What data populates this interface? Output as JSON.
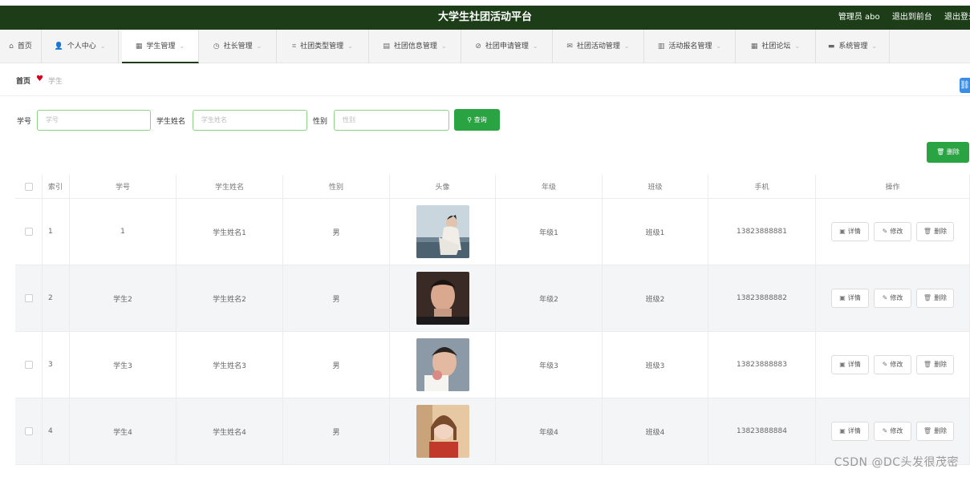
{
  "header": {
    "title": "大学生社团活动平台",
    "admin": "管理员 abo",
    "to_front": "退出到前台",
    "logout": "退出登录"
  },
  "nav": [
    {
      "label": "首页",
      "icon": "home-icon",
      "glyph": "⌂",
      "chevron": false
    },
    {
      "label": "个人中心",
      "icon": "user-icon",
      "glyph": "👤",
      "chevron": true
    },
    {
      "label": "学生管理",
      "icon": "grid-icon",
      "glyph": "▦",
      "chevron": true,
      "active": true
    },
    {
      "label": "社长管理",
      "icon": "clock-icon",
      "glyph": "◷",
      "chevron": true
    },
    {
      "label": "社团类型管理",
      "icon": "crop-icon",
      "glyph": "⌗",
      "chevron": true
    },
    {
      "label": "社团信息管理",
      "icon": "clipboard-icon",
      "glyph": "▤",
      "chevron": true
    },
    {
      "label": "社团申请管理",
      "icon": "compass-icon",
      "glyph": "⊘",
      "chevron": true
    },
    {
      "label": "社团活动管理",
      "icon": "mail-icon",
      "glyph": "✉",
      "chevron": true
    },
    {
      "label": "活动报名管理",
      "icon": "chart-icon",
      "glyph": "▥",
      "chevron": true
    },
    {
      "label": "社团论坛",
      "icon": "table-icon",
      "glyph": "▦",
      "chevron": true
    },
    {
      "label": "系统管理",
      "icon": "monitor-icon",
      "glyph": "▬",
      "chevron": true
    }
  ],
  "breadcrumb": {
    "home": "首页",
    "current": "学生"
  },
  "search": {
    "id_label": "学号",
    "id_placeholder": "学号",
    "name_label": "学生姓名",
    "name_placeholder": "学生姓名",
    "gender_label": "性别",
    "gender_placeholder": "性别",
    "query_button": "查询"
  },
  "delete_button": "删除",
  "table": {
    "columns": [
      "",
      "索引",
      "学号",
      "学生姓名",
      "性别",
      "头像",
      "年级",
      "班级",
      "手机",
      "操作"
    ],
    "rows": [
      {
        "index": "1",
        "id": "1",
        "name": "学生姓名1",
        "gender": "男",
        "grade": "年级1",
        "class": "班级1",
        "phone": "13823888881"
      },
      {
        "index": "2",
        "id": "学生2",
        "name": "学生姓名2",
        "gender": "男",
        "grade": "年级2",
        "class": "班级2",
        "phone": "13823888882"
      },
      {
        "index": "3",
        "id": "学生3",
        "name": "学生姓名3",
        "gender": "男",
        "grade": "年级3",
        "class": "班级3",
        "phone": "13823888883"
      },
      {
        "index": "4",
        "id": "学生4",
        "name": "学生姓名4",
        "gender": "男",
        "grade": "年级4",
        "class": "班级4",
        "phone": "13823888884"
      }
    ],
    "actions": {
      "detail": "详情",
      "edit": "修改",
      "delete": "删除"
    }
  },
  "watermark": "CSDN @DC头发很茂密",
  "colors": {
    "header": "#1c3d18",
    "primary": "#2aa343",
    "heart": "#d0021b"
  }
}
